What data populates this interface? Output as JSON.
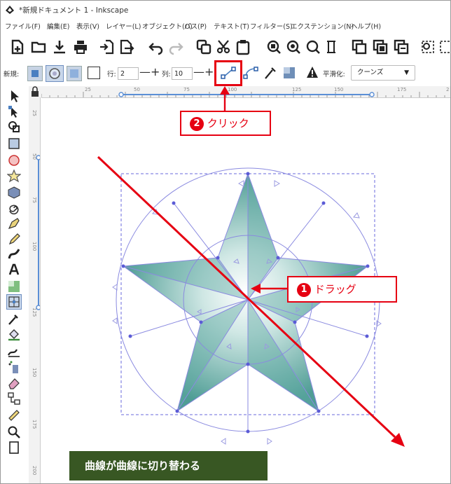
{
  "window": {
    "title": "*新規ドキュメント 1 - Inkscape"
  },
  "menu": [
    "ファイル(F)",
    "編集(E)",
    "表示(V)",
    "レイヤー(L)",
    "オブジェクト(O)",
    "パス(P)",
    "テキスト(T)",
    "フィルター(S)",
    "エクステンション(N)",
    "ヘルプ(H)"
  ],
  "toolctl": {
    "new_label": "新規:",
    "rows_label": "行:",
    "rows_value": "2",
    "cols_label": "列:",
    "cols_value": "10",
    "smooth_label": "平滑化:",
    "smooth_value": "クーンズ"
  },
  "ruler": {
    "h_ticks": [
      "25",
      "50",
      "75",
      "100",
      "125",
      "150",
      "175",
      "2"
    ],
    "v_ticks": [
      "25",
      "50",
      "75",
      "100",
      "125",
      "150",
      "175",
      "200"
    ]
  },
  "annotations": {
    "click_num": "2",
    "click_text": "クリック",
    "drag_num": "1",
    "drag_text": "ドラッグ",
    "caption": "曲線が曲線に切り替わる"
  },
  "colors": {
    "accent_red": "#e60012",
    "caption_bg": "#385723",
    "mesh_teal": "#5ea9a2",
    "guide_blue": "#5b5bd6"
  }
}
